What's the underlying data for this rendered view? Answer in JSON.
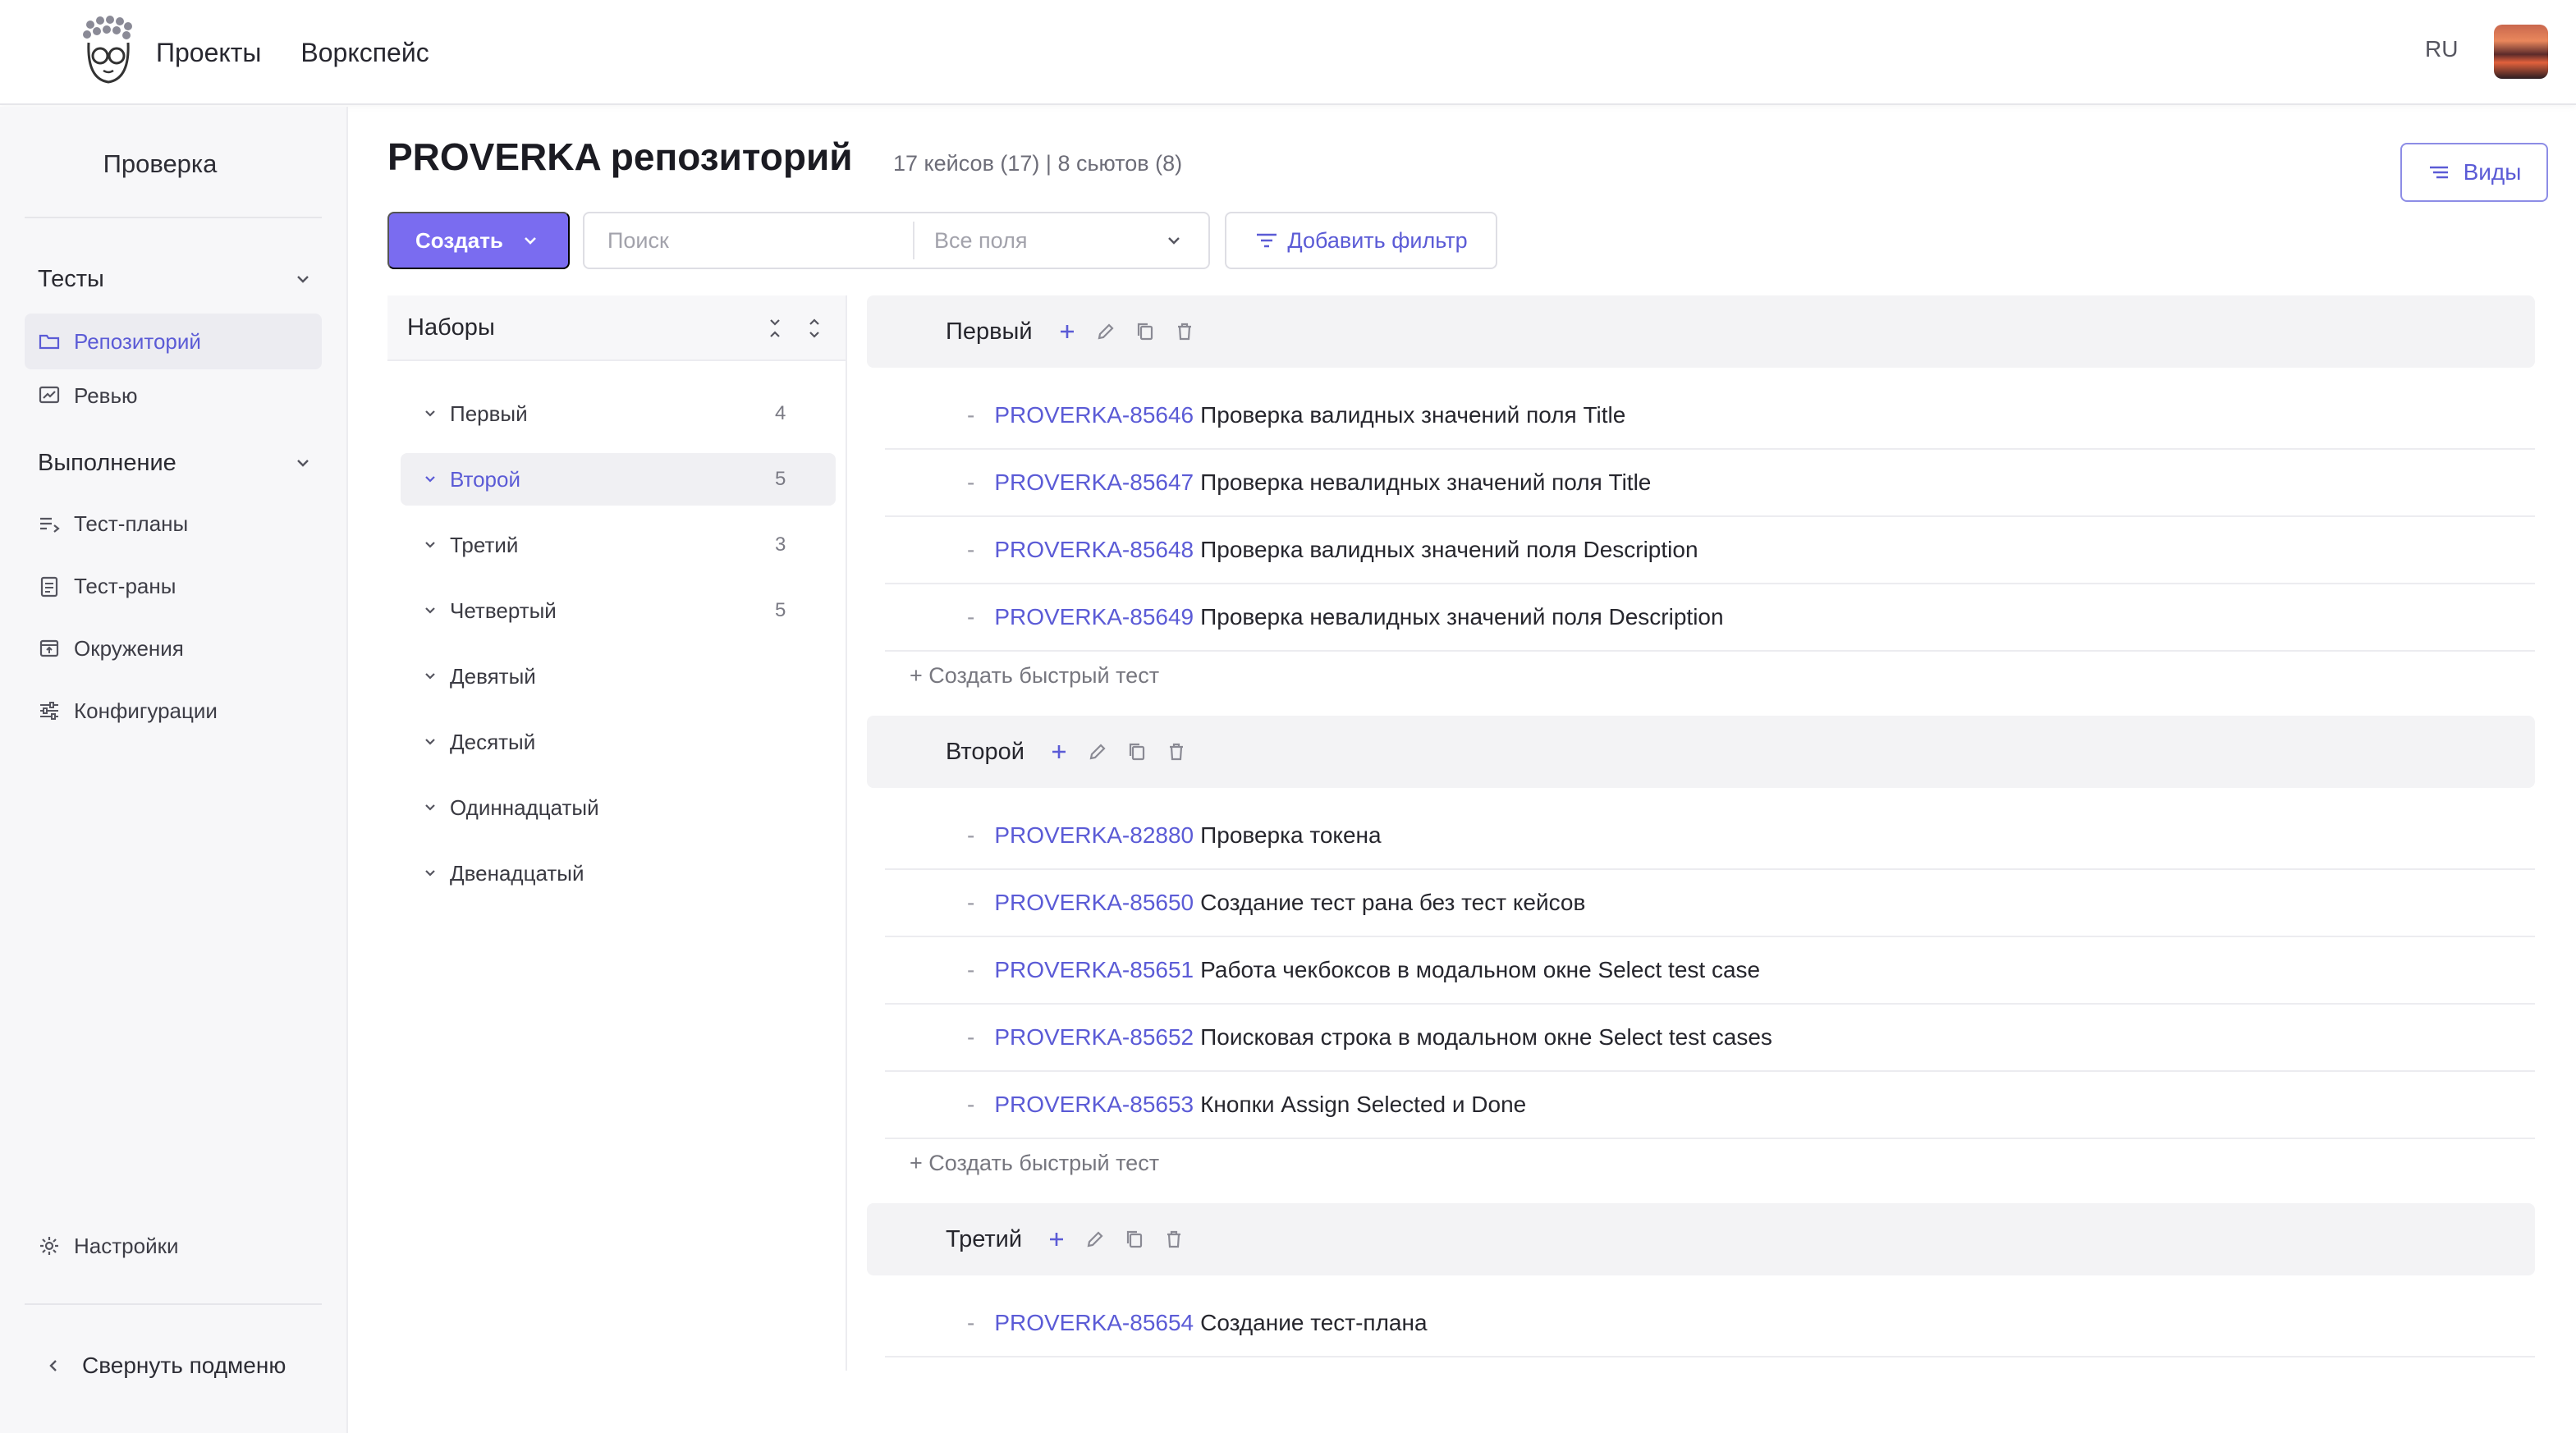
{
  "topbar": {
    "nav": [
      "Проекты",
      "Воркспейс"
    ],
    "lang": "RU"
  },
  "sidebar": {
    "project_title": "Проверка",
    "groups": [
      {
        "label": "Тесты",
        "items": [
          {
            "label": "Репозиторий",
            "icon": "folder-icon",
            "active": true
          },
          {
            "label": "Ревью",
            "icon": "review-icon",
            "active": false
          }
        ]
      },
      {
        "label": "Выполнение",
        "items": [
          {
            "label": "Тест-планы",
            "icon": "list-icon",
            "active": false
          },
          {
            "label": "Тест-раны",
            "icon": "clipboard-icon",
            "active": false
          },
          {
            "label": "Окружения",
            "icon": "environment-icon",
            "active": false
          },
          {
            "label": "Конфигурации",
            "icon": "sliders-icon",
            "active": false
          }
        ]
      }
    ],
    "settings": "Настройки",
    "collapse": "Свернуть подменю"
  },
  "page": {
    "title": "PROVERKA репозиторий",
    "stats": "17 кейсов (17) | 8 сьютов (8)",
    "views_label": "Виды"
  },
  "toolbar": {
    "create_label": "Создать",
    "search_placeholder": "Поиск",
    "field_select": "Все поля",
    "add_filter": "Добавить фильтр"
  },
  "suites": {
    "header": "Наборы",
    "items": [
      {
        "name": "Первый",
        "count": "4",
        "active": false
      },
      {
        "name": "Второй",
        "count": "5",
        "active": true
      },
      {
        "name": "Третий",
        "count": "3",
        "active": false
      },
      {
        "name": "Четвертый",
        "count": "5",
        "active": false
      },
      {
        "name": "Девятый",
        "count": "",
        "active": false
      },
      {
        "name": "Десятый",
        "count": "",
        "active": false
      },
      {
        "name": "Одиннадцатый",
        "count": "",
        "active": false
      },
      {
        "name": "Двенадцатый",
        "count": "",
        "active": false
      }
    ]
  },
  "case_groups": [
    {
      "name": "Первый",
      "cases": [
        {
          "id": "PROVERKA-85646",
          "title": "Проверка валидных значений поля Title"
        },
        {
          "id": "PROVERKA-85647",
          "title": "Проверка невалидных значений поля Title"
        },
        {
          "id": "PROVERKA-85648",
          "title": "Проверка валидных значений поля Description"
        },
        {
          "id": "PROVERKA-85649",
          "title": "Проверка невалидных значений поля Description"
        }
      ],
      "quick_create": "+ Создать быстрый тест"
    },
    {
      "name": "Второй",
      "cases": [
        {
          "id": "PROVERKA-82880",
          "title": "Проверка токена"
        },
        {
          "id": "PROVERKA-85650",
          "title": "Создание тест рана без тест кейсов"
        },
        {
          "id": "PROVERKA-85651",
          "title": "Работа чекбоксов в модальном окне Select test case"
        },
        {
          "id": "PROVERKA-85652",
          "title": "Поисковая строка в модальном окне Select test cases"
        },
        {
          "id": "PROVERKA-85653",
          "title": "Кнопки Assign Selected и Done"
        }
      ],
      "quick_create": "+ Создать быстрый тест"
    },
    {
      "name": "Третий",
      "cases": [
        {
          "id": "PROVERKA-85654",
          "title": "Создание тест-плана"
        }
      ]
    }
  ]
}
